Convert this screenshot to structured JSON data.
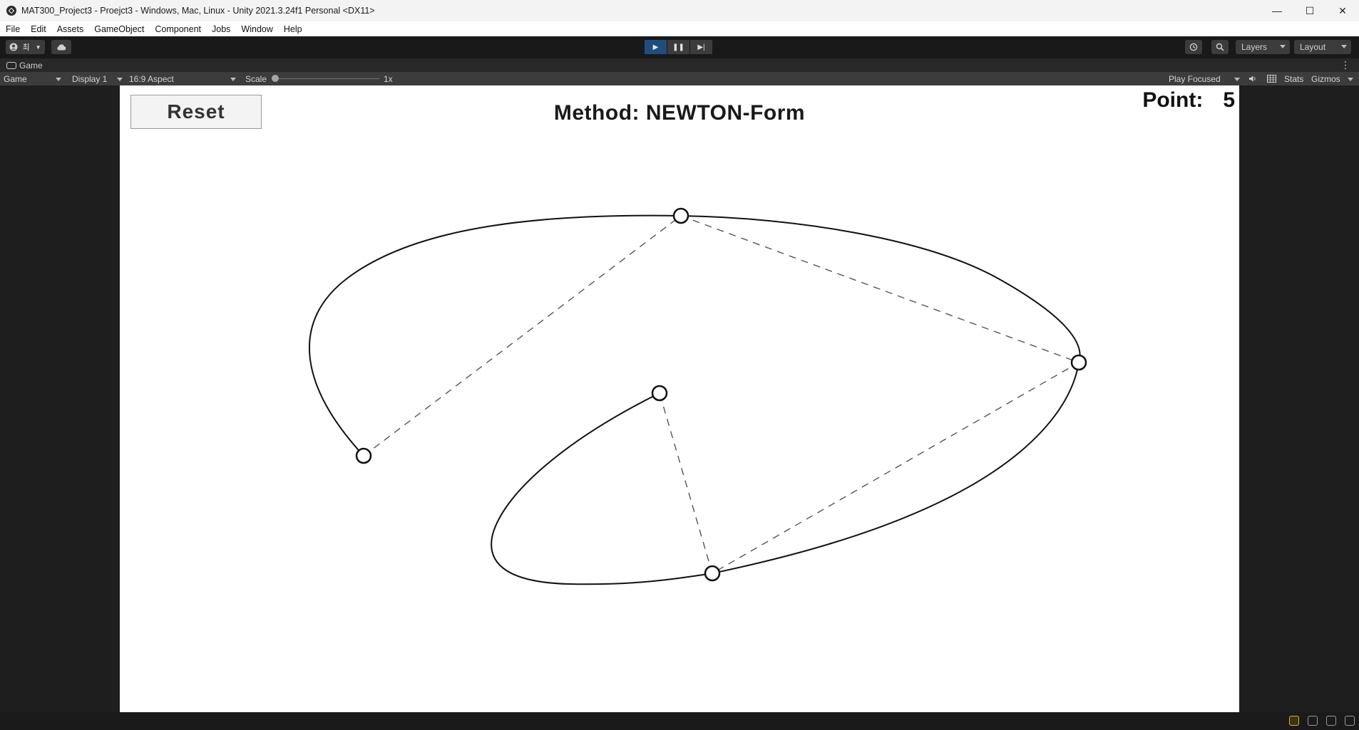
{
  "window": {
    "title": "MAT300_Project3 - Proejct3 - Windows, Mac, Linux - Unity 2021.3.24f1 Personal <DX11>",
    "controls": {
      "minimize": "—",
      "maximize": "☐",
      "close": "✕"
    }
  },
  "menu": {
    "items": [
      "File",
      "Edit",
      "Assets",
      "GameObject",
      "Component",
      "Jobs",
      "Window",
      "Help"
    ]
  },
  "toolbar": {
    "account_label": "최",
    "play_icons": {
      "play": "▶",
      "pause": "❚❚",
      "step": "▶|"
    },
    "layers_label": "Layers",
    "layout_label": "Layout"
  },
  "tab": {
    "label": "Game",
    "more": "⋮"
  },
  "gamebar": {
    "mode": "Game",
    "display": "Display 1",
    "aspect": "16:9 Aspect",
    "scale_label": "Scale",
    "scale_value": "1x",
    "play_focused": "Play Focused",
    "stats": "Stats",
    "gizmos": "Gizmos"
  },
  "game": {
    "reset_label": "Reset",
    "method_label": "Method: NEWTON-Form",
    "point_label": "Point:",
    "point_count": "5"
  },
  "colors": {
    "viewport_bg": "#ffffff",
    "editor_bg": "#1e1e1e",
    "play_active": "#1f4e7c"
  }
}
